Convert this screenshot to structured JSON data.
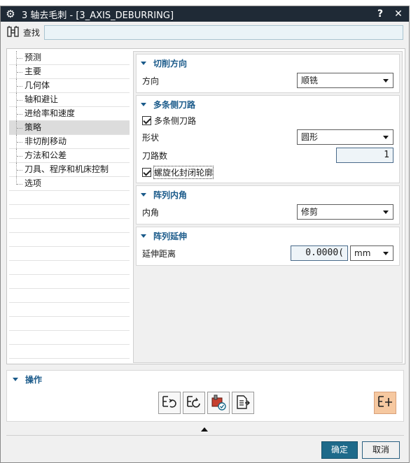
{
  "window": {
    "title": "3 轴去毛刺 - [3_AXIS_DEBURRING]",
    "help_label": "?",
    "close_label": "✕"
  },
  "find": {
    "label": "查找",
    "value": ""
  },
  "tree": {
    "items": [
      {
        "label": "预测"
      },
      {
        "label": "主要"
      },
      {
        "label": "几何体"
      },
      {
        "label": "轴和避让"
      },
      {
        "label": "进给率和速度"
      },
      {
        "label": "策略",
        "selected": true
      },
      {
        "label": "非切削移动"
      },
      {
        "label": "方法和公差"
      },
      {
        "label": "刀具、程序和机床控制"
      },
      {
        "label": "选项"
      }
    ]
  },
  "sections": {
    "cut_direction": {
      "title": "切削方向",
      "direction_label": "方向",
      "direction_value": "顺铣"
    },
    "multi_passes": {
      "title": "多条侧刀路",
      "multi_checkbox_label": "多条侧刀路",
      "multi_checked": true,
      "shape_label": "形状",
      "shape_value": "圆形",
      "pass_count_label": "刀路数",
      "pass_count_value": "1",
      "spiral_checkbox_label": "螺旋化封闭轮廓",
      "spiral_checked": true
    },
    "array_corner": {
      "title": "阵列内角",
      "corner_label": "内角",
      "corner_value": "修剪"
    },
    "array_extend": {
      "title": "阵列延伸",
      "distance_label": "延伸距离",
      "distance_value": "0.0000(",
      "unit_value": "mm"
    }
  },
  "operations": {
    "title": "操作",
    "icons": [
      "generate-icon",
      "replay-icon",
      "verify-icon",
      "list-icon",
      "multi-gen-icon"
    ]
  },
  "buttons": {
    "ok": "确定",
    "cancel": "取消"
  },
  "colors": {
    "accent": "#1e6a8a",
    "header_text": "#1a5a8a",
    "title_bar": "#1f2a36",
    "highlight": "#f6c8a0"
  }
}
